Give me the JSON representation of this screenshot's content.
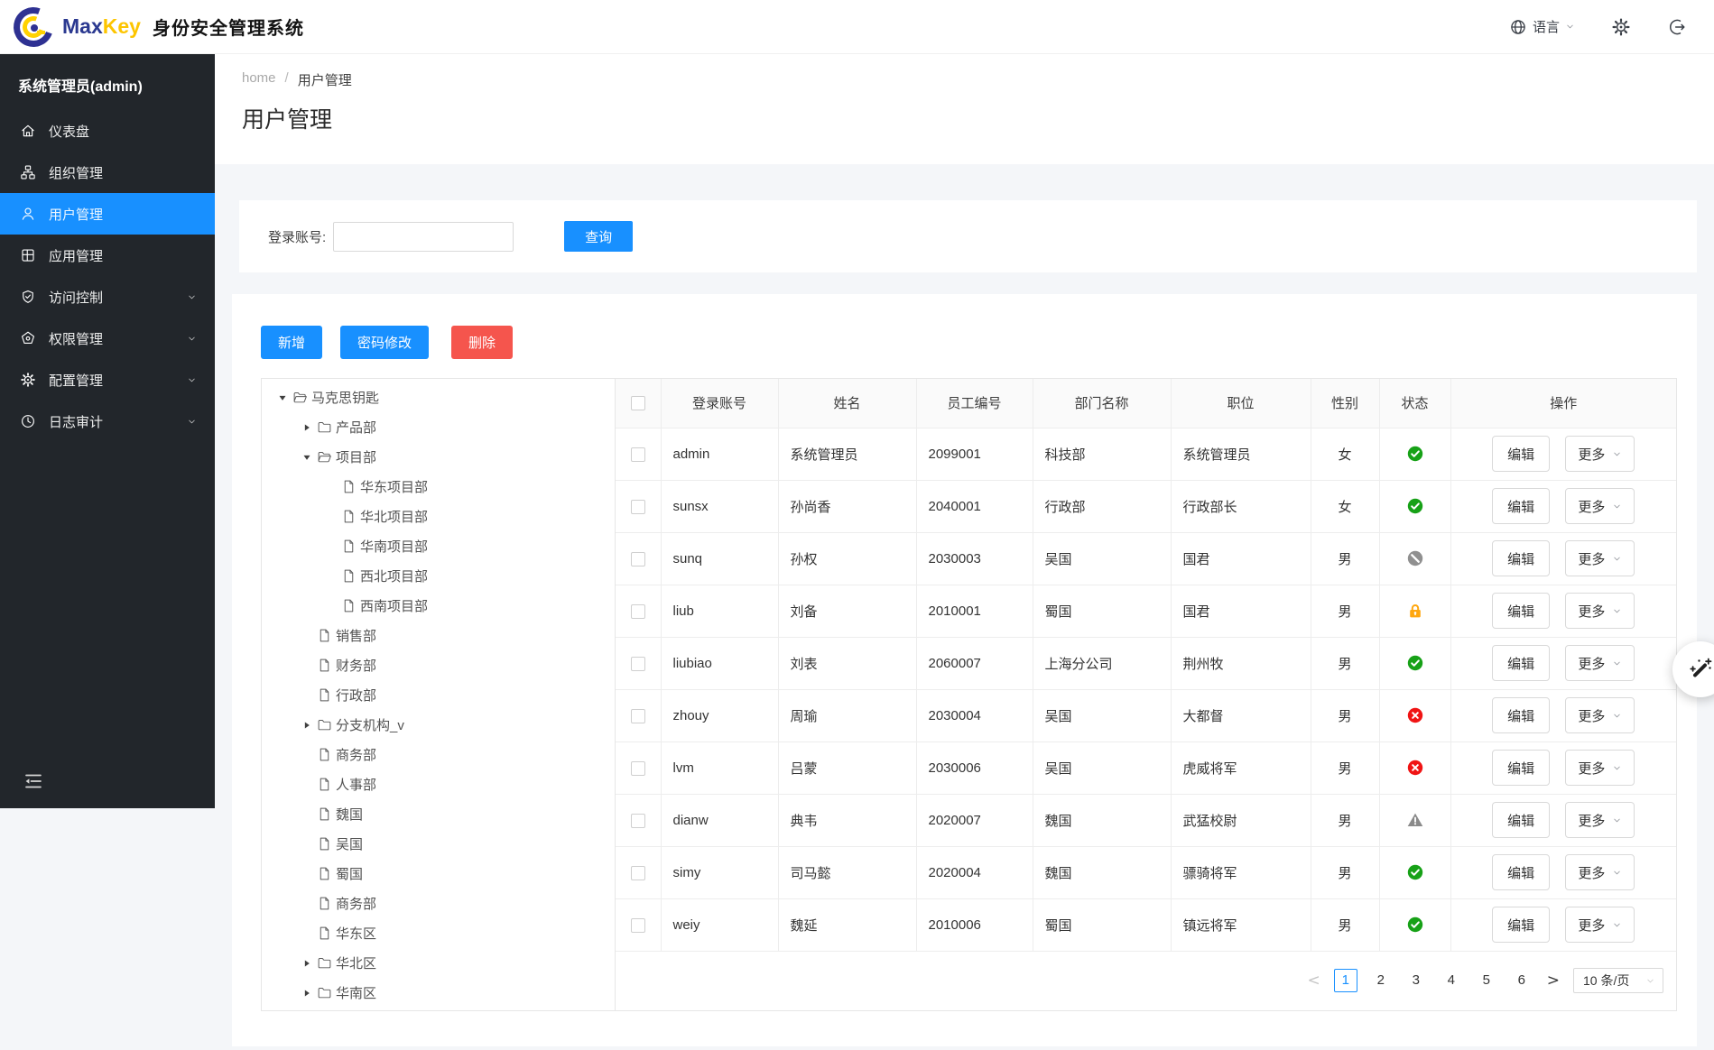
{
  "header": {
    "brand_max": "Max",
    "brand_key": "Key",
    "app_title": "身份安全管理系统",
    "language_label": "语言"
  },
  "sidebar": {
    "user_title": "系统管理员(admin)",
    "items": [
      {
        "key": "dashboard",
        "label": "仪表盘",
        "icon": "home-icon",
        "active": false,
        "has_chevron": false
      },
      {
        "key": "organization",
        "label": "组织管理",
        "icon": "org-icon",
        "active": false,
        "has_chevron": false
      },
      {
        "key": "users",
        "label": "用户管理",
        "icon": "user-icon",
        "active": true,
        "has_chevron": false
      },
      {
        "key": "applications",
        "label": "应用管理",
        "icon": "app-icon",
        "active": false,
        "has_chevron": false
      },
      {
        "key": "access-control",
        "label": "访问控制",
        "icon": "shield-icon",
        "active": false,
        "has_chevron": true
      },
      {
        "key": "permissions",
        "label": "权限管理",
        "icon": "pentagon-icon",
        "active": false,
        "has_chevron": true
      },
      {
        "key": "configuration",
        "label": "配置管理",
        "icon": "gear-icon",
        "active": false,
        "has_chevron": true
      },
      {
        "key": "audit-log",
        "label": "日志审计",
        "icon": "clock-icon",
        "active": false,
        "has_chevron": true
      }
    ]
  },
  "breadcrumb": {
    "home": "home",
    "separator": "/",
    "current": "用户管理"
  },
  "page_title": "用户管理",
  "search": {
    "label": "登录账号:",
    "input_value": "",
    "query_button": "查询"
  },
  "toolbar": {
    "add": "新增",
    "change_password": "密码修改",
    "delete": "删除"
  },
  "tree": {
    "items": [
      {
        "label": "马克思钥匙",
        "level": 0,
        "type": "folder-open",
        "caret": "down"
      },
      {
        "label": "产品部",
        "level": 1,
        "type": "folder",
        "caret": "right"
      },
      {
        "label": "项目部",
        "level": 1,
        "type": "folder-open",
        "caret": "down"
      },
      {
        "label": "华东项目部",
        "level": 2,
        "type": "leaf",
        "caret": "none"
      },
      {
        "label": "华北项目部",
        "level": 2,
        "type": "leaf",
        "caret": "none"
      },
      {
        "label": "华南项目部",
        "level": 2,
        "type": "leaf",
        "caret": "none"
      },
      {
        "label": "西北项目部",
        "level": 2,
        "type": "leaf",
        "caret": "none"
      },
      {
        "label": "西南项目部",
        "level": 2,
        "type": "leaf",
        "caret": "none"
      },
      {
        "label": "销售部",
        "level": 1,
        "type": "leaf",
        "caret": "none"
      },
      {
        "label": "财务部",
        "level": 1,
        "type": "leaf",
        "caret": "none"
      },
      {
        "label": "行政部",
        "level": 1,
        "type": "leaf",
        "caret": "none"
      },
      {
        "label": "分支机构_v",
        "level": 1,
        "type": "folder",
        "caret": "right"
      },
      {
        "label": "商务部",
        "level": 1,
        "type": "leaf",
        "caret": "none"
      },
      {
        "label": "人事部",
        "level": 1,
        "type": "leaf",
        "caret": "none"
      },
      {
        "label": "魏国",
        "level": 1,
        "type": "leaf",
        "caret": "none"
      },
      {
        "label": "吴国",
        "level": 1,
        "type": "leaf",
        "caret": "none"
      },
      {
        "label": "蜀国",
        "level": 1,
        "type": "leaf",
        "caret": "none"
      },
      {
        "label": "商务部",
        "level": 1,
        "type": "leaf",
        "caret": "none"
      },
      {
        "label": "华东区",
        "level": 1,
        "type": "leaf",
        "caret": "none"
      },
      {
        "label": "华北区",
        "level": 1,
        "type": "folder",
        "caret": "right"
      },
      {
        "label": "华南区",
        "level": 1,
        "type": "folder",
        "caret": "right"
      }
    ]
  },
  "table": {
    "columns": [
      "登录账号",
      "姓名",
      "员工编号",
      "部门名称",
      "职位",
      "性别",
      "状态",
      "操作"
    ],
    "edit_label": "编辑",
    "more_label": "更多",
    "rows": [
      {
        "username": "admin",
        "name": "系统管理员",
        "employee_id": "2099001",
        "department": "科技部",
        "job": "系统管理员",
        "gender": "女",
        "status": "enabled"
      },
      {
        "username": "sunsx",
        "name": "孙尚香",
        "employee_id": "2040001",
        "department": "行政部",
        "job": "行政部长",
        "gender": "女",
        "status": "enabled"
      },
      {
        "username": "sunq",
        "name": "孙权",
        "employee_id": "2030003",
        "department": "吴国",
        "job": "国君",
        "gender": "男",
        "status": "inactive"
      },
      {
        "username": "liub",
        "name": "刘备",
        "employee_id": "2010001",
        "department": "蜀国",
        "job": "国君",
        "gender": "男",
        "status": "locked"
      },
      {
        "username": "liubiao",
        "name": "刘表",
        "employee_id": "2060007",
        "department": "上海分公司",
        "job": "荆州牧",
        "gender": "男",
        "status": "enabled"
      },
      {
        "username": "zhouy",
        "name": "周瑜",
        "employee_id": "2030004",
        "department": "吴国",
        "job": "大都督",
        "gender": "男",
        "status": "disabled"
      },
      {
        "username": "lvm",
        "name": "吕蒙",
        "employee_id": "2030006",
        "department": "吴国",
        "job": "虎威将军",
        "gender": "男",
        "status": "disabled"
      },
      {
        "username": "dianw",
        "name": "典韦",
        "employee_id": "2020007",
        "department": "魏国",
        "job": "武猛校尉",
        "gender": "男",
        "status": "warning"
      },
      {
        "username": "simy",
        "name": "司马懿",
        "employee_id": "2020004",
        "department": "魏国",
        "job": "骠骑将军",
        "gender": "男",
        "status": "enabled"
      },
      {
        "username": "weiy",
        "name": "魏延",
        "employee_id": "2010006",
        "department": "蜀国",
        "job": "镇远将军",
        "gender": "男",
        "status": "enabled"
      }
    ]
  },
  "pagination": {
    "prev": "<",
    "next": ">",
    "pages": [
      "1",
      "2",
      "3",
      "4",
      "5",
      "6"
    ],
    "active_page": "1",
    "page_size": "10 条/页"
  },
  "colors": {
    "accent": "#1890ff",
    "danger": "#f5554d",
    "sidebar_bg": "#22262b",
    "status_enabled": "#17a117",
    "status_inactive": "#909090",
    "status_locked": "#ffa70f",
    "status_disabled": "#f01414",
    "status_warning": "#8a8a8a"
  }
}
